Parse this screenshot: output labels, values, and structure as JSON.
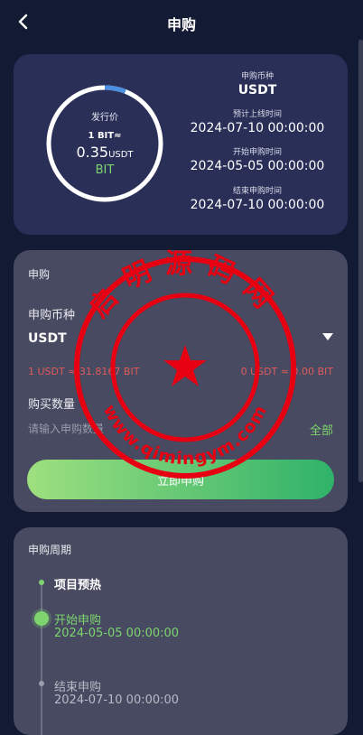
{
  "header": {
    "title": "申购",
    "back_icon": "chevron-left-icon"
  },
  "info": {
    "ring_label": "发行价",
    "ring_rate": "1 BIT≈",
    "ring_price": "0.35",
    "ring_price_unit": "USDT",
    "ring_token": "BIT",
    "ring_progress": 0.06,
    "currency_label": "申购币种",
    "currency_value": "USDT",
    "listing_label": "预计上线时间",
    "listing_value": "2024-07-10 00:00:00",
    "start_label": "开始申购时间",
    "start_value": "2024-05-05 00:00:00",
    "end_label": "结束申购时间",
    "end_value": "2024-07-10 00:00:00"
  },
  "subscribe": {
    "section_title": "申购",
    "currency_label": "申购币种",
    "currency_value": "USDT",
    "rate_left": "1 USDT ≈ 31.8167 BIT",
    "rate_right": "0 USDT ≈ 0.00 BIT",
    "quantity_label": "购买数量",
    "quantity_placeholder": "请输入申购数量",
    "all_label": "全部",
    "submit_label": "立即申购"
  },
  "period": {
    "section_title": "申购周期",
    "steps": [
      {
        "title": "项目预热"
      },
      {
        "title": "开始申购",
        "time": "2024-05-05 00:00:00"
      },
      {
        "title": "结束申购",
        "time": "2024-07-10 00:00:00"
      }
    ]
  },
  "watermark": {
    "top_text": "启明源码网",
    "bottom_text": "www.qimingym.com"
  },
  "colors": {
    "background": "#131a33",
    "info_card": "#2a2f58",
    "card": "#474a60",
    "accent_green": "#7ed56f",
    "rate_red": "#e05a5a",
    "stamp_red": "#e60012"
  }
}
